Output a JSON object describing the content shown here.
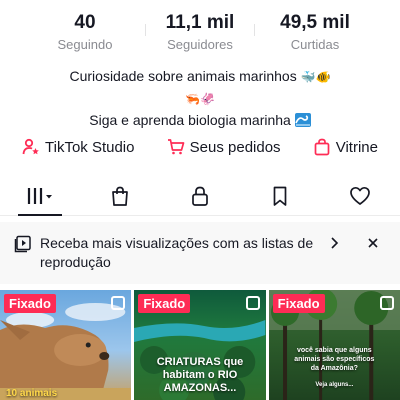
{
  "profile": {
    "stats": [
      {
        "value": "40",
        "label": "Seguindo"
      },
      {
        "value": "11,1 mil",
        "label": "Seguidores"
      },
      {
        "value": "49,5 mil",
        "label": "Curtidas"
      }
    ],
    "bio_line1": "Curiosidade sobre animais marinhos",
    "bio_line1_emojis": "🐳🐠",
    "bio_line2_emojis": "🦐🦑",
    "bio_line3": "Siga e aprenda biologia marinha"
  },
  "links": [
    {
      "label": "TikTok Studio",
      "icon": "person-star-icon"
    },
    {
      "label": "Seus pedidos",
      "icon": "cart-icon"
    },
    {
      "label": "Vitrine",
      "icon": "shopping-bag-icon"
    }
  ],
  "tabs": [
    {
      "name": "videos",
      "icon": "grid-icon",
      "active": true
    },
    {
      "name": "shop",
      "icon": "bag-icon"
    },
    {
      "name": "private",
      "icon": "lock-icon"
    },
    {
      "name": "saved",
      "icon": "bookmark-icon"
    },
    {
      "name": "liked",
      "icon": "heart-icon"
    }
  ],
  "banner": {
    "text": "Receba mais visualizações com as listas de reprodução"
  },
  "videos": [
    {
      "badge": "Fixado",
      "caption": "10 animais"
    },
    {
      "badge": "Fixado",
      "caption": "CRIATURAS que habitam o RIO AMAZONAS..."
    },
    {
      "badge": "Fixado",
      "caption": "você sabia que alguns animais são específicos da Amazônia?",
      "caption_small": "Veja alguns..."
    }
  ],
  "colors": {
    "accent": "#fe2c55",
    "text": "#161823",
    "muted": "#8a8b91"
  }
}
